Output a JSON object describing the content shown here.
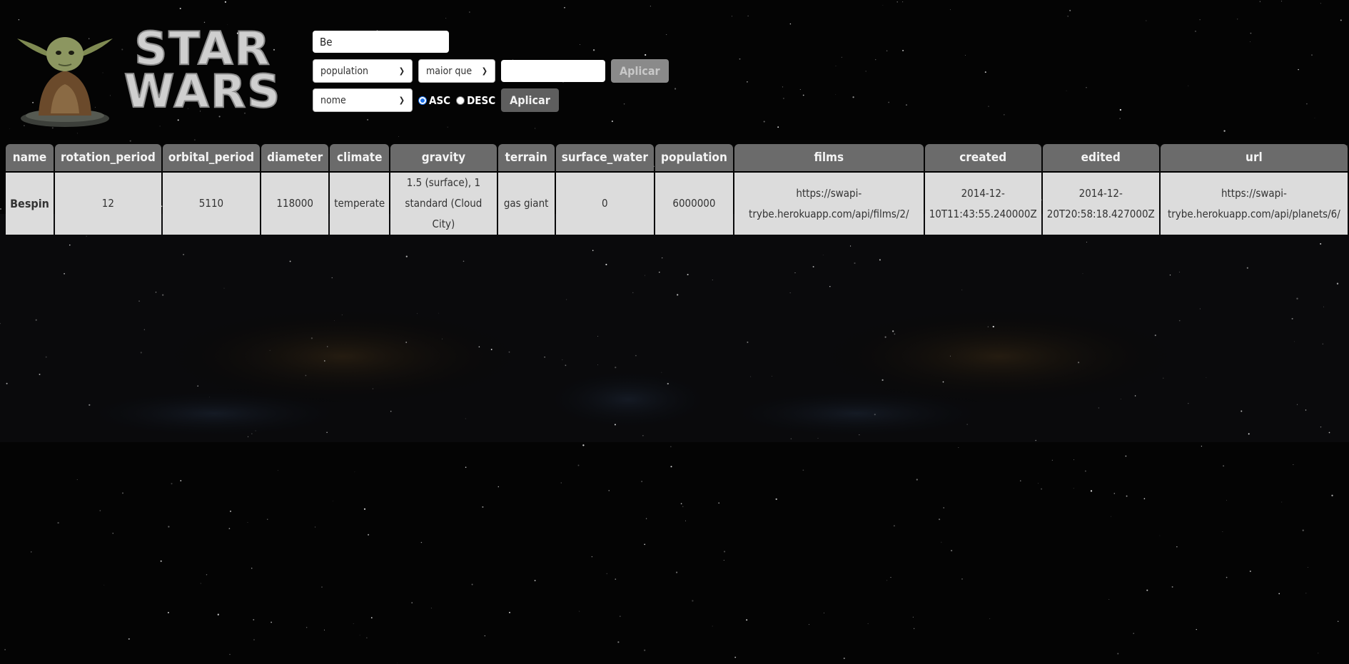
{
  "logo": {
    "text": "STAR WARS"
  },
  "search": {
    "value": "Be",
    "placeholder": ""
  },
  "filter": {
    "column": "population",
    "comparison": "maior que",
    "value": "",
    "apply_label": "Aplicar"
  },
  "sort": {
    "column": "nome",
    "asc_label": "ASC",
    "desc_label": "DESC",
    "selected": "ASC",
    "apply_label": "Aplicar"
  },
  "table": {
    "headers": [
      "name",
      "rotation_period",
      "orbital_period",
      "diameter",
      "climate",
      "gravity",
      "terrain",
      "surface_water",
      "population",
      "films",
      "created",
      "edited",
      "url"
    ],
    "rows": [
      {
        "name": "Bespin",
        "rotation_period": "12",
        "orbital_period": "5110",
        "diameter": "118000",
        "climate": "temperate",
        "gravity": "1.5 (surface), 1 standard (Cloud City)",
        "terrain": "gas giant",
        "surface_water": "0",
        "population": "6000000",
        "films": "https://swapi-trybe.herokuapp.com/api/films/2/",
        "created": "2014-12-10T11:43:55.240000Z",
        "edited": "2014-12-20T20:58:18.427000Z",
        "url": "https://swapi-trybe.herokuapp.com/api/planets/6/"
      }
    ]
  },
  "colors": {
    "background": "#040404",
    "header_cell": "#6b6b6b",
    "body_cell": "#dcdcdc",
    "button_disabled": "#8a8a8a",
    "button_active": "#5e5e5e",
    "radio_accent": "#1a6ee6"
  }
}
